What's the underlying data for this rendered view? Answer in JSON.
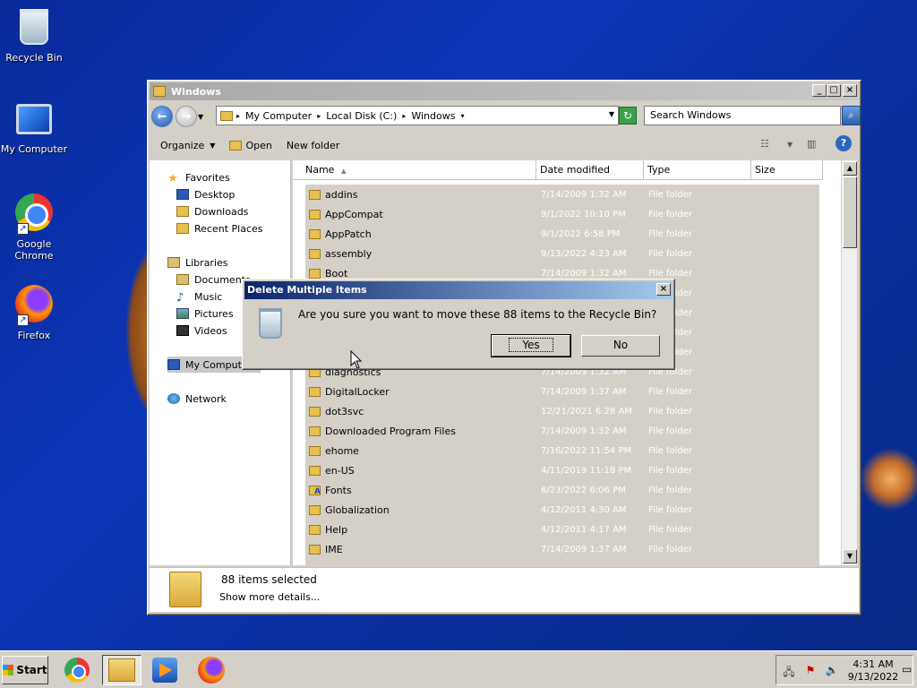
{
  "desktop": {
    "icons": [
      {
        "label": "Recycle Bin",
        "icon": "recycle-bin-icon"
      },
      {
        "label": "My Computer",
        "icon": "computer-icon"
      },
      {
        "label": "Google Chrome",
        "icon": "chrome-icon"
      },
      {
        "label": "Firefox",
        "icon": "firefox-icon"
      }
    ]
  },
  "explorer": {
    "title": "Windows",
    "address": {
      "crumbs": [
        "My Computer",
        "Local Disk (C:)",
        "Windows"
      ]
    },
    "search": {
      "placeholder": "Search Windows"
    },
    "toolbar": {
      "organize": "Organize",
      "open": "Open",
      "new_folder": "New folder"
    },
    "nav": {
      "favorites": "Favorites",
      "favorites_items": [
        "Desktop",
        "Downloads",
        "Recent Places"
      ],
      "libraries": "Libraries",
      "libraries_items": [
        "Documents",
        "Music",
        "Pictures",
        "Videos"
      ],
      "my_computer": "My Computer",
      "network": "Network"
    },
    "columns": [
      "Name",
      "Date modified",
      "Type",
      "Size"
    ],
    "files": [
      {
        "name": "addins",
        "date": "7/14/2009 1:32 AM",
        "type": "File folder"
      },
      {
        "name": "AppCompat",
        "date": "9/1/2022 10:10 PM",
        "type": "File folder"
      },
      {
        "name": "AppPatch",
        "date": "9/1/2022 6:58 PM",
        "type": "File folder"
      },
      {
        "name": "assembly",
        "date": "9/13/2022 4:23 AM",
        "type": "File folder"
      },
      {
        "name": "Boot",
        "date": "7/14/2009 1:32 AM",
        "type": "File folder"
      },
      {
        "name": "",
        "date": "",
        "type": "File folder"
      },
      {
        "name": "",
        "date": "",
        "type": "File folder"
      },
      {
        "name": "",
        "date": "",
        "type": "File folder"
      },
      {
        "name": "",
        "date": "",
        "type": "File folder"
      },
      {
        "name": "diagnostics",
        "date": "7/14/2009 1:32 AM",
        "type": "File folder"
      },
      {
        "name": "DigitalLocker",
        "date": "7/14/2009 1:37 AM",
        "type": "File folder"
      },
      {
        "name": "dot3svc",
        "date": "12/21/2021 6:28 AM",
        "type": "File folder"
      },
      {
        "name": "Downloaded Program Files",
        "date": "7/14/2009 1:32 AM",
        "type": "File folder"
      },
      {
        "name": "ehome",
        "date": "7/16/2022 11:54 PM",
        "type": "File folder"
      },
      {
        "name": "en-US",
        "date": "4/11/2019 11:18 PM",
        "type": "File folder"
      },
      {
        "name": "Fonts",
        "date": "6/23/2022 6:06 PM",
        "type": "File folder"
      },
      {
        "name": "Globalization",
        "date": "4/12/2011 4:30 AM",
        "type": "File folder"
      },
      {
        "name": "Help",
        "date": "4/12/2011 4:17 AM",
        "type": "File folder"
      },
      {
        "name": "IME",
        "date": "7/14/2009 1:37 AM",
        "type": "File folder"
      }
    ],
    "details": {
      "count": "88 items selected",
      "more": "Show more details..."
    }
  },
  "dialog": {
    "title": "Delete Multiple Items",
    "message": "Are you sure you want to move these 88 items to the Recycle Bin?",
    "yes": "Yes",
    "no": "No"
  },
  "taskbar": {
    "start": "Start",
    "time": "4:31 AM",
    "date": "9/13/2022"
  }
}
